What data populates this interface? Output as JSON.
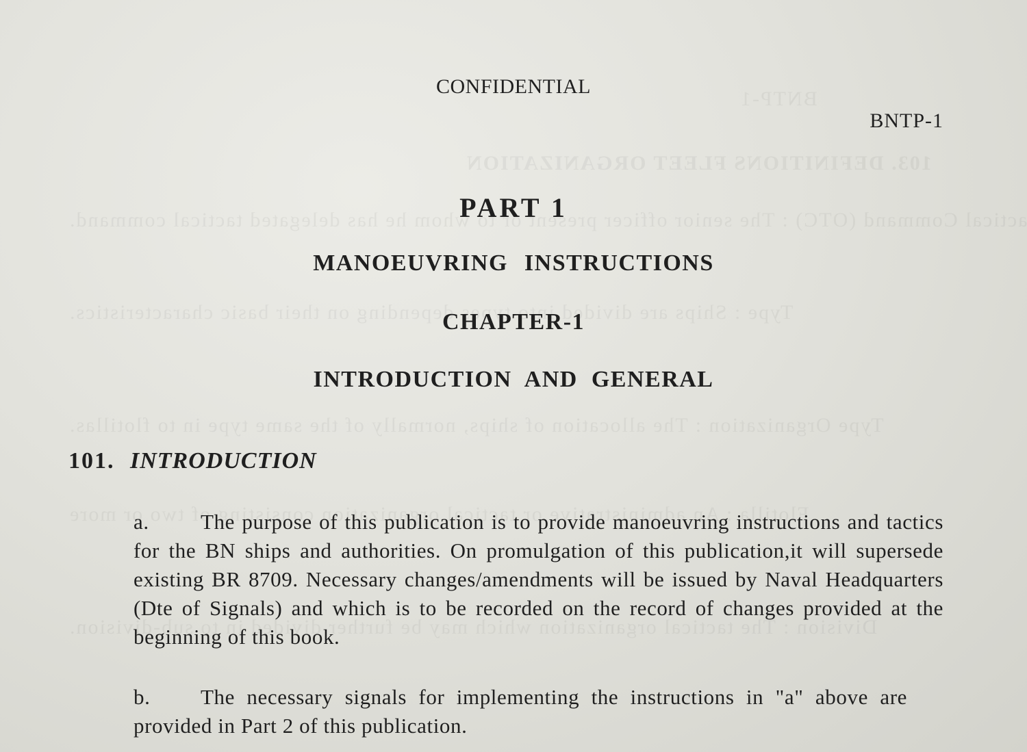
{
  "header": {
    "classification": "CONFIDENTIAL",
    "document_code": "BNTP-1"
  },
  "headings": {
    "part": "PART 1",
    "section": "MANOEUVRING INSTRUCTIONS",
    "chapter": "CHAPTER-1",
    "title": "INTRODUCTION AND GENERAL"
  },
  "section_101": {
    "number": "101.",
    "title": "INTRODUCTION",
    "paragraphs": [
      {
        "label": "a.",
        "text": "The purpose of this publication is to provide manoeuvring instructions and tactics for the BN ships and authorities. On promulgation of this publication,it will supersede existing BR 8709. Necessary changes/amendments will be issued by Naval Headquarters (Dte of Signals) and which is to be recorded on the record of changes provided at the beginning of this book."
      },
      {
        "label": "b.",
        "text": "The necessary signals for implementing the instructions in \"a\" above are provided in Part 2 of this publication."
      }
    ]
  }
}
